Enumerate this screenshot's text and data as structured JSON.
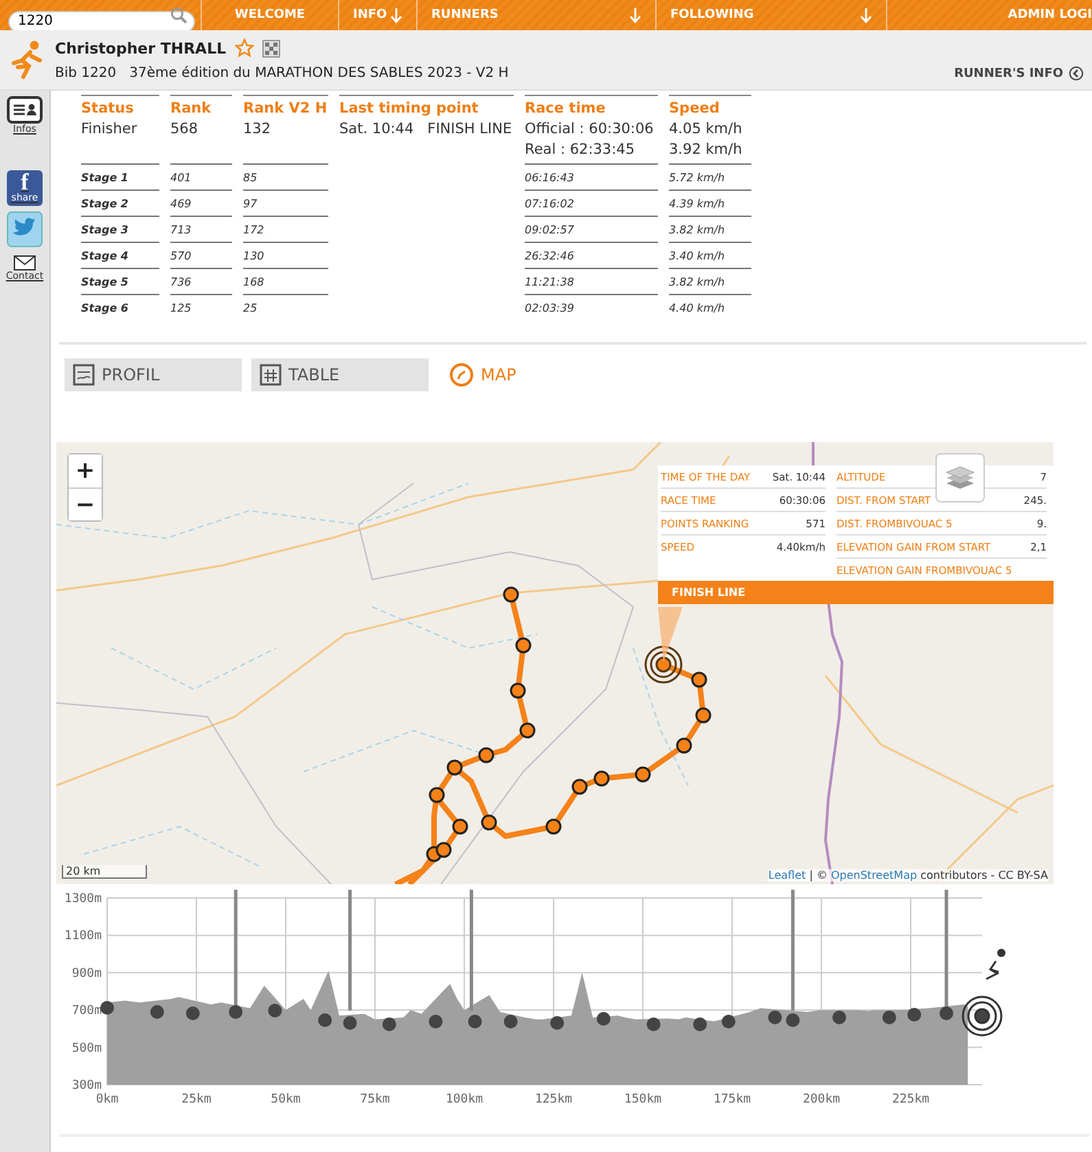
{
  "nav": {
    "search": {
      "value": "1220"
    },
    "items": [
      {
        "label": "WELCOME",
        "dropdown": false
      },
      {
        "label": "INFO",
        "dropdown": true
      },
      {
        "label": "RUNNERS",
        "dropdown": true
      },
      {
        "label": "FOLLOWING",
        "dropdown": true
      },
      {
        "label": "ADMIN LOGI",
        "dropdown": false
      }
    ]
  },
  "runner": {
    "name": "Christopher THRALL",
    "favorite": false,
    "subtitle": "Bib 1220   37ème édition du MARATHON DES SABLES 2023 - V2 H",
    "info_link": "RUNNER'S INFO"
  },
  "sidebar": {
    "items": [
      {
        "kind": "infos",
        "label": "Infos"
      },
      {
        "kind": "facebook",
        "glyph": "f",
        "label": "share"
      },
      {
        "kind": "twitter"
      },
      {
        "kind": "contact",
        "label": "Contact"
      }
    ]
  },
  "summary": {
    "columns": [
      "Status",
      "Rank",
      "Rank V2 H",
      "Last timing point",
      "Race time",
      "Speed"
    ],
    "status": "Finisher",
    "rank": "568",
    "rank_category": "132",
    "last_timing_point": "Sat. 10:44   FINISH LINE",
    "race_time": [
      "Official : 60:30:06",
      "Real : 62:33:45"
    ],
    "speed": [
      "4.05 km/h",
      "3.92 km/h"
    ]
  },
  "stages": [
    {
      "name": "Stage 1",
      "rank": "401",
      "rank_category": "85",
      "time": "06:16:43",
      "speed": "5.72 km/h"
    },
    {
      "name": "Stage 2",
      "rank": "469",
      "rank_category": "97",
      "time": "07:16:02",
      "speed": "4.39 km/h"
    },
    {
      "name": "Stage 3",
      "rank": "713",
      "rank_category": "172",
      "time": "09:02:57",
      "speed": "3.82 km/h"
    },
    {
      "name": "Stage 4",
      "rank": "570",
      "rank_category": "130",
      "time": "26:32:46",
      "speed": "3.40 km/h"
    },
    {
      "name": "Stage 5",
      "rank": "736",
      "rank_category": "168",
      "time": "11:21:38",
      "speed": "3.82 km/h"
    },
    {
      "name": "Stage 6",
      "rank": "125",
      "rank_category": "25",
      "time": "02:03:39",
      "speed": "4.40 km/h"
    }
  ],
  "tabs": [
    {
      "kind": "profile",
      "label": "PROFIL",
      "selected": false
    },
    {
      "kind": "table",
      "label": "TABLE",
      "selected": false
    },
    {
      "kind": "map",
      "label": "MAP",
      "selected": true
    }
  ],
  "map": {
    "zoom_in": "+",
    "zoom_out": "−",
    "scale": "20 km",
    "attribution": {
      "leaflet": "Leaflet",
      "separator": " | © ",
      "osm": "OpenStreetMap",
      "rest": " contributors - CC BY-SA"
    },
    "popup": {
      "title": "FINISH LINE",
      "left": [
        {
          "label": "TIME OF THE DAY",
          "value": "Sat. 10:44"
        },
        {
          "label": "RACE TIME",
          "value": "60:30:06"
        },
        {
          "label": "POINTS RANKING",
          "value": "571"
        },
        {
          "label": "SPEED",
          "value": "4.40km/h"
        }
      ],
      "right": [
        {
          "label": "ALTITUDE",
          "value": "7"
        },
        {
          "label": "DIST. FROM START",
          "value": "245."
        },
        {
          "label": "DIST. FROMBIVOUAC 5",
          "value": "9."
        },
        {
          "label": "ELEVATION GAIN FROM START",
          "value": "2,1"
        },
        {
          "label": "ELEVATION GAIN FROMBIVOUAC 5"
        }
      ]
    }
  },
  "profile": {
    "chart_data": {
      "type": "area",
      "grid": true,
      "x": [
        0,
        5,
        9,
        18,
        20,
        29,
        32,
        40,
        44,
        50,
        55,
        57,
        62,
        65,
        72,
        75,
        83,
        85,
        88,
        96,
        98,
        100,
        107,
        110,
        117,
        120,
        122,
        130,
        133,
        136,
        143,
        145,
        148,
        157,
        160,
        162,
        170,
        178,
        180,
        183,
        196,
        200,
        210,
        213,
        215,
        222,
        230,
        240,
        241
      ],
      "series": [
        {
          "color": "#a0a0a0",
          "values": [
            740,
            750,
            740,
            760,
            770,
            730,
            740,
            710,
            830,
            700,
            760,
            700,
            910,
            670,
            680,
            650,
            660,
            700,
            680,
            840,
            760,
            700,
            780,
            690,
            660,
            650,
            650,
            670,
            900,
            660,
            670,
            660,
            650,
            655,
            650,
            660,
            640,
            680,
            690,
            710,
            690,
            700,
            700,
            695,
            700,
            700,
            710,
            730,
            720
          ]
        }
      ],
      "xlim": [
        0,
        245
      ],
      "ylim": [
        300,
        1300
      ],
      "xticks": [
        {
          "value": 0,
          "label": "0km"
        },
        {
          "value": 25,
          "label": "25km"
        },
        {
          "value": 50,
          "label": "50km"
        },
        {
          "value": 75,
          "label": "75km"
        },
        {
          "value": 100,
          "label": "100km"
        },
        {
          "value": 125,
          "label": "125km"
        },
        {
          "value": 150,
          "label": "150km"
        },
        {
          "value": 175,
          "label": "175km"
        },
        {
          "value": 200,
          "label": "200km"
        },
        {
          "value": 225,
          "label": "225km"
        }
      ],
      "yticks": [
        {
          "value": 300,
          "label": "300m"
        },
        {
          "value": 500,
          "label": "500m"
        },
        {
          "value": 700,
          "label": "700m"
        },
        {
          "value": 900,
          "label": "900m"
        },
        {
          "value": 1100,
          "label": "1100m"
        },
        {
          "value": 1300,
          "label": "1300m"
        }
      ]
    }
  }
}
